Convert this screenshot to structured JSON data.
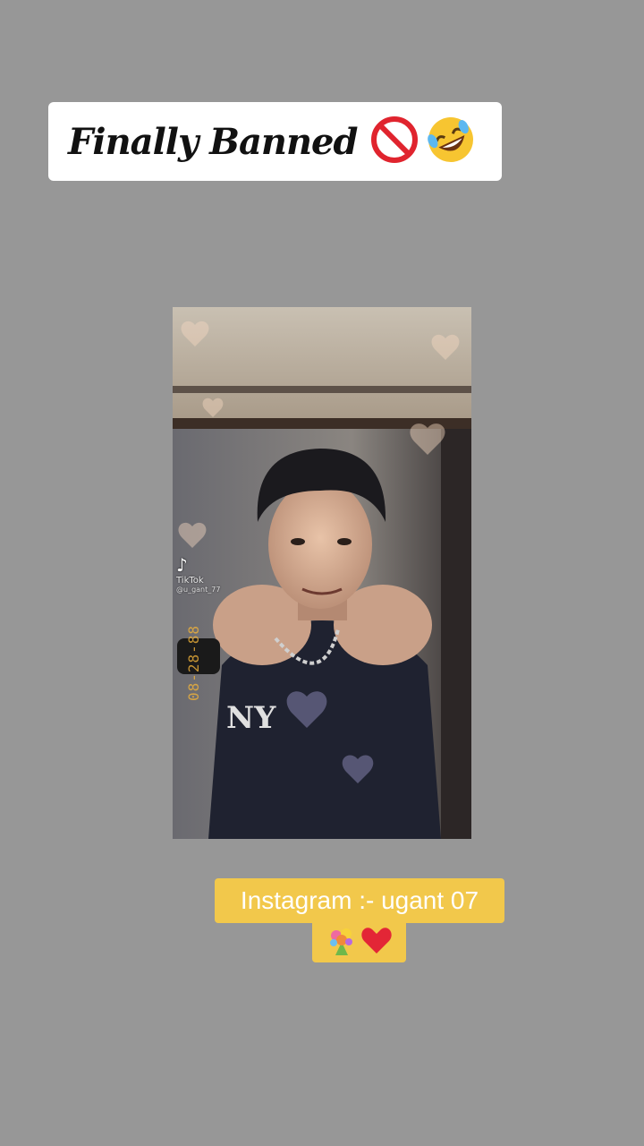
{
  "title_card": {
    "text": "Finally Banned",
    "icons": [
      "prohibited-icon",
      "rolling-laughing-emoji-icon"
    ]
  },
  "photo": {
    "watermark_name": "TikTok",
    "watermark_handle": "@u_gant_77",
    "date_stamp": "08-28-88"
  },
  "caption": {
    "line1": "Instagram :- ugant 07",
    "icons": [
      "bouquet-emoji-icon",
      "red-heart-icon"
    ]
  },
  "colors": {
    "background": "#979797",
    "caption_bg": "#f2c84b",
    "title_bg": "#ffffff"
  }
}
